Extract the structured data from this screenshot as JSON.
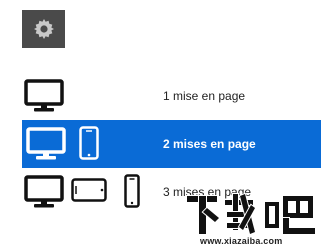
{
  "colors": {
    "accent": "#0a6bd6",
    "gear_bg": "#4a4a4a"
  },
  "settings": {
    "icon": "gear-icon"
  },
  "layouts": [
    {
      "label": "1 mise en page",
      "selected": false,
      "icons": [
        "monitor-icon"
      ]
    },
    {
      "label": "2 mises en page",
      "selected": true,
      "icons": [
        "monitor-icon",
        "tablet-portrait-icon"
      ]
    },
    {
      "label": "3 mises en page",
      "selected": false,
      "icons": [
        "monitor-icon",
        "tablet-landscape-icon",
        "phone-icon"
      ]
    }
  ],
  "watermark": {
    "logo_text": "下载吧",
    "url": "www.xiazaiba.com"
  }
}
